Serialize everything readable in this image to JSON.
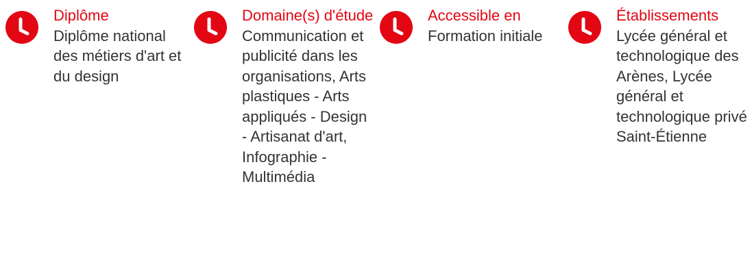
{
  "accent_color": "#e30613",
  "text_color": "#333333",
  "icon": "clock-icon",
  "blocks": [
    {
      "title": "Diplôme",
      "value": "Diplôme national des métiers d'art et du design"
    },
    {
      "title": "Domaine(s) d'étude",
      "value": "Communication et publicité dans les organisations, Arts plastiques - Arts appliqués - Design - Artisanat d'art, Infographie - Multimédia"
    },
    {
      "title": "Accessible en",
      "value": "Formation initiale"
    },
    {
      "title": "Établissements",
      "value": "Lycée général et technologique des Arènes, Lycée général et technologique privé Saint-Étienne"
    }
  ]
}
